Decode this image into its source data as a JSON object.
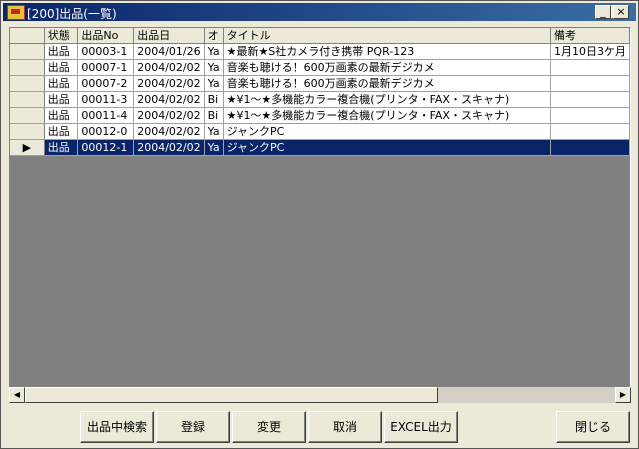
{
  "window": {
    "title": "[200]出品(一覧)"
  },
  "columns": [
    "",
    "状態",
    "出品No",
    "出品日",
    "オ",
    "タイトル",
    "備考"
  ],
  "rows": [
    {
      "status": "出品",
      "no": "00003-1",
      "date": "2004/01/26",
      "o": "Ya",
      "title": "★最新★S社カメラ付き携帯 PQR-123",
      "note": "1月10日3ケ月"
    },
    {
      "status": "出品",
      "no": "00007-1",
      "date": "2004/02/02",
      "o": "Ya",
      "title": "音楽も聴ける！600万画素の最新デジカメ",
      "note": ""
    },
    {
      "status": "出品",
      "no": "00007-2",
      "date": "2004/02/02",
      "o": "Ya",
      "title": "音楽も聴ける！600万画素の最新デジカメ",
      "note": ""
    },
    {
      "status": "出品",
      "no": "00011-3",
      "date": "2004/02/02",
      "o": "Bi",
      "title": "★¥1〜★多機能カラー複合機(プリンタ・FAX・スキャナ)",
      "note": ""
    },
    {
      "status": "出品",
      "no": "00011-4",
      "date": "2004/02/02",
      "o": "Bi",
      "title": "★¥1〜★多機能カラー複合機(プリンタ・FAX・スキャナ)",
      "note": ""
    },
    {
      "status": "出品",
      "no": "00012-0",
      "date": "2004/02/02",
      "o": "Ya",
      "title": "ジャンクPC",
      "note": ""
    },
    {
      "status": "出品",
      "no": "00012-1",
      "date": "2004/02/02",
      "o": "Ya",
      "title": "ジャンクPC",
      "note": "",
      "selected": true
    }
  ],
  "row_marker": "▶",
  "buttons": {
    "search": "出品中検索",
    "register": "登録",
    "change": "変更",
    "cancel": "取消",
    "excel": "EXCEL出力",
    "close": "閉じる"
  },
  "titlebar_buttons": {
    "min": "_",
    "max": "□",
    "close": "×"
  },
  "scroll_arrows": {
    "left": "◀",
    "right": "▶"
  }
}
